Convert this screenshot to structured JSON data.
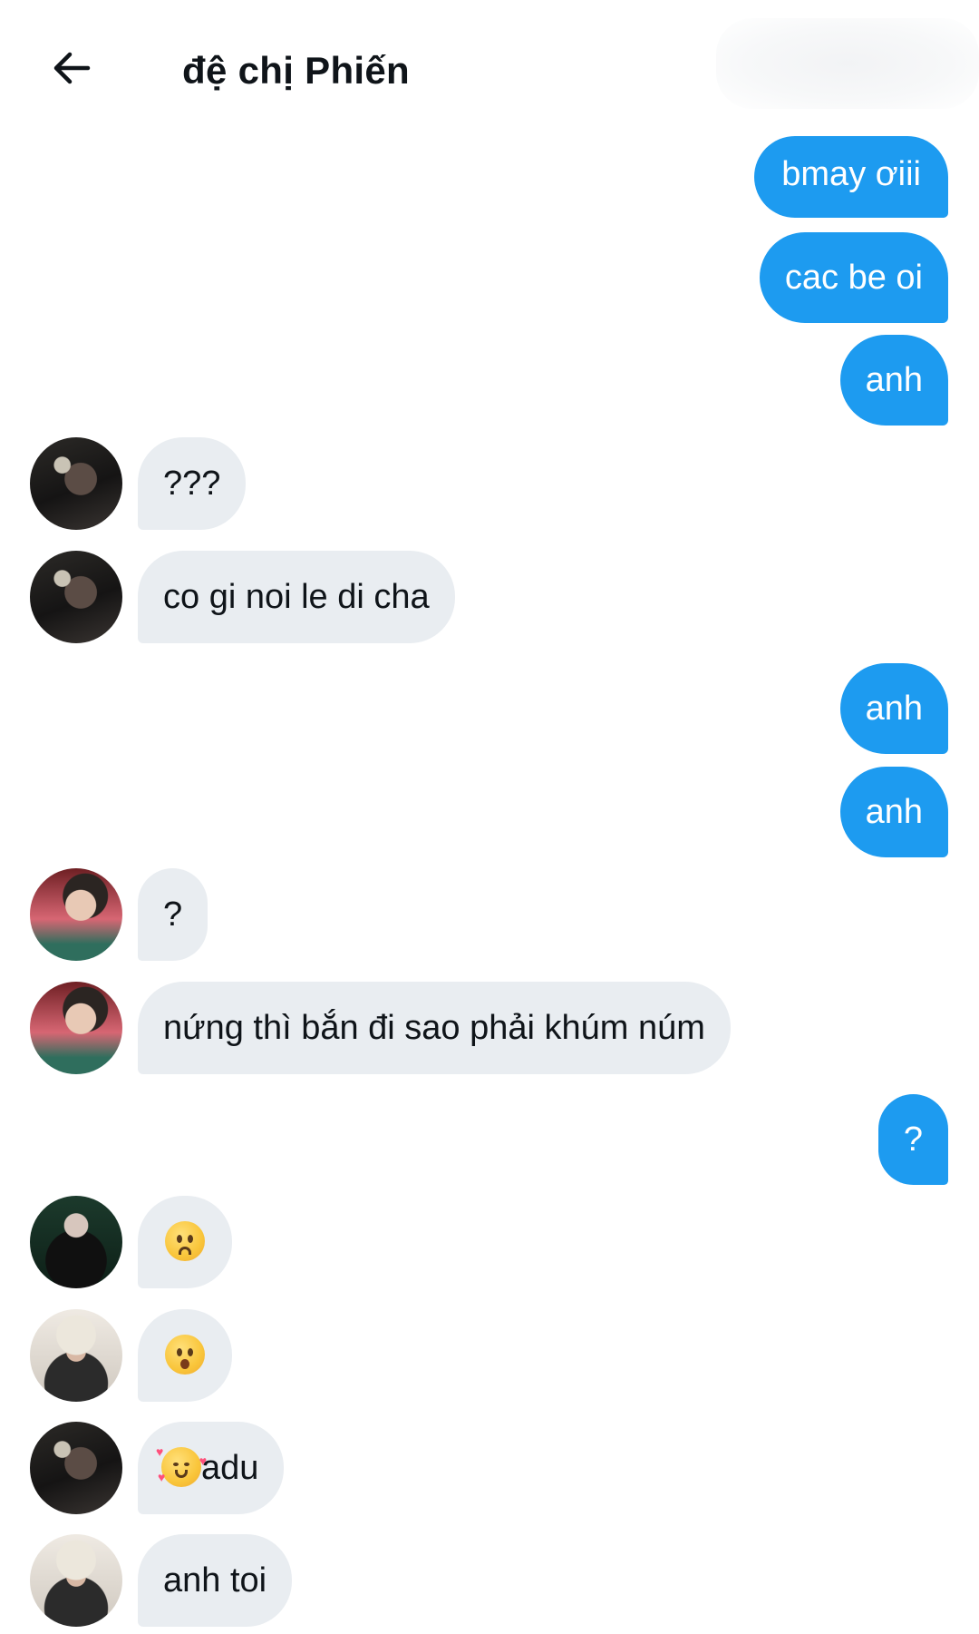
{
  "header": {
    "title": "đệ chị Phiến"
  },
  "messages": [
    {
      "dir": "out",
      "text": "bmay ơiii"
    },
    {
      "dir": "out",
      "text": "cac be oi"
    },
    {
      "dir": "out",
      "text": "anh"
    },
    {
      "dir": "in",
      "avatar": "avatar-user-a",
      "text": "???"
    },
    {
      "dir": "in",
      "avatar": "avatar-user-a",
      "text": "co gi noi le di cha"
    },
    {
      "dir": "out",
      "text": "anh"
    },
    {
      "dir": "out",
      "text": "anh"
    },
    {
      "dir": "in",
      "avatar": "avatar-user-b",
      "text": "?"
    },
    {
      "dir": "in",
      "avatar": "avatar-user-b",
      "text": "nứng thì bắn đi sao phải khúm núm"
    },
    {
      "dir": "out",
      "text": "?"
    },
    {
      "dir": "in",
      "avatar": "avatar-user-c",
      "emoji": "worried-face-emoji"
    },
    {
      "dir": "in",
      "avatar": "avatar-user-d",
      "emoji": "frowning-open-mouth-emoji"
    },
    {
      "dir": "in",
      "avatar": "avatar-user-a",
      "emoji": "smiling-face-with-hearts-emoji",
      "text": "adu"
    },
    {
      "dir": "in",
      "avatar": "avatar-user-d",
      "text": "anh toi"
    }
  ],
  "colors": {
    "outgoing_bubble": "#1d9bf0",
    "incoming_bubble": "#e9edf1"
  }
}
